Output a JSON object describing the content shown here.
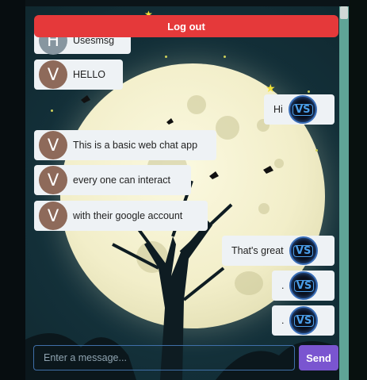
{
  "header": {
    "logout_label": "Log out"
  },
  "messages": [
    {
      "side": "received",
      "avatar": "H",
      "text": "Usesmsg"
    },
    {
      "side": "received",
      "avatar": "V",
      "text": "HELLO"
    },
    {
      "side": "sent",
      "avatar": "VS",
      "text": "Hi"
    },
    {
      "side": "received",
      "avatar": "V",
      "text": "This is a basic web chat app"
    },
    {
      "side": "received",
      "avatar": "V",
      "text": "every one can interact"
    },
    {
      "side": "received",
      "avatar": "V",
      "text": "with their google account"
    },
    {
      "side": "sent",
      "avatar": "VS",
      "text": "That's great"
    },
    {
      "side": "sent",
      "avatar": "VS",
      "text": "."
    },
    {
      "side": "sent",
      "avatar": "VS",
      "text": "."
    }
  ],
  "composer": {
    "placeholder": "Enter a message...",
    "send_label": "Send"
  },
  "colors": {
    "logout": "#e5393a",
    "send": "#7a55d0",
    "bubble": "#eef2f5",
    "avatar_v": "#8e6a5a"
  }
}
